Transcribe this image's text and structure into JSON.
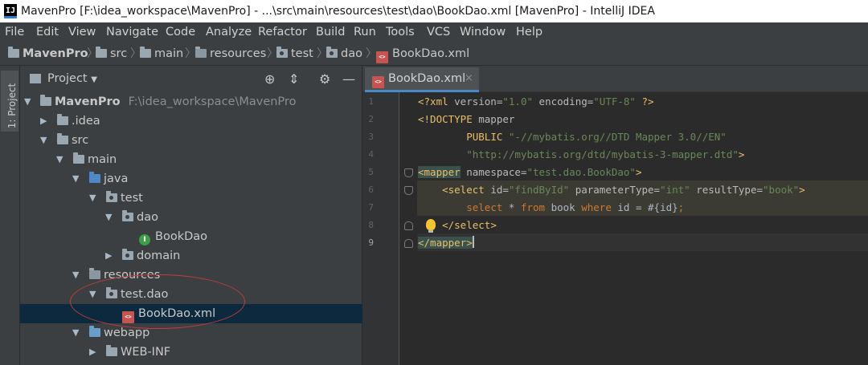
{
  "window": {
    "logo_text": "IJ",
    "title": "MavenPro [F:\\idea_workspace\\MavenPro] - ...\\src\\main\\resources\\test\\dao\\BookDao.xml [MavenPro] - IntelliJ IDEA"
  },
  "menu": [
    "File",
    "Edit",
    "View",
    "Navigate",
    "Code",
    "Analyze",
    "Refactor",
    "Build",
    "Run",
    "Tools",
    "VCS",
    "Window",
    "Help"
  ],
  "breadcrumb": [
    "MavenPro",
    "src",
    "main",
    "resources",
    "test",
    "dao",
    "BookDao.xml"
  ],
  "tool_window": {
    "stripe_label": "1: Project",
    "title": "Project",
    "dropdown_icon": "triangle-down",
    "actions": [
      "locate-target-icon",
      "collapse-all-icon",
      "gear-icon",
      "minimize-icon"
    ]
  },
  "tree": {
    "root": {
      "name": "MavenPro",
      "path": "F:\\idea_workspace\\MavenPro"
    },
    "idea": ".idea",
    "src": "src",
    "main": "main",
    "java": "java",
    "test": "test",
    "dao": "dao",
    "bookdao_class": "BookDao",
    "domain": "domain",
    "resources": "resources",
    "test_dao": "test.dao",
    "bookdao_xml": "BookDao.xml",
    "webapp": "webapp",
    "webinf": "WEB-INF"
  },
  "editor": {
    "tab": {
      "label": "BookDao.xml",
      "close": "×"
    },
    "xml_icon_text": "<>",
    "class_icon_text": "I",
    "line_numbers": [
      "1",
      "2",
      "3",
      "4",
      "5",
      "6",
      "7",
      "8",
      "9"
    ],
    "lines": {
      "l1": {
        "open": "<?xml ",
        "a1": "version=",
        "v1": "\"1.0\"",
        "a2": " encoding=",
        "v2": "\"UTF-8\"",
        "close": " ?>"
      },
      "l2": {
        "indent": "",
        "decl": "<!DOCTYPE",
        "rest": " mapper"
      },
      "l3": {
        "indent": "        ",
        "kw": "PUBLIC",
        "sp": " ",
        "val": "\"-//mybatis.org//DTD Mapper 3.0//EN\""
      },
      "l4": {
        "indent": "        ",
        "val": "\"http://mybatis.org/dtd/mybatis-3-mapper.dtd\"",
        "close": ">"
      },
      "l5": {
        "tag": "<mapper",
        "attr": " namespace=",
        "val": "\"test.dao.BookDao\"",
        "close": ">"
      },
      "l6": {
        "indent": "    ",
        "tag": "<select",
        "a1": " id=",
        "v1": "\"findById\"",
        "a2": " parameterType=",
        "v2": "\"int\"",
        "a3": " resultType=",
        "v3": "\"book\"",
        "close": ">"
      },
      "l7": {
        "indent": "        ",
        "k1": "select",
        "t1": " * ",
        "k2": "from",
        "t2": " book ",
        "k3": "where",
        "t3": " id = #{id}",
        "end": ";"
      },
      "l8": {
        "indent": "    ",
        "tag": "</select",
        "close": ">"
      },
      "l9": {
        "tag": "</mapper",
        "close": ">"
      }
    }
  },
  "colors": {
    "tag": "#e8bf6a",
    "attribute_value": "#6a8759",
    "keyword": "#cc7832",
    "selection": "#0d293e",
    "annotation_circle": "#c23d3d"
  }
}
